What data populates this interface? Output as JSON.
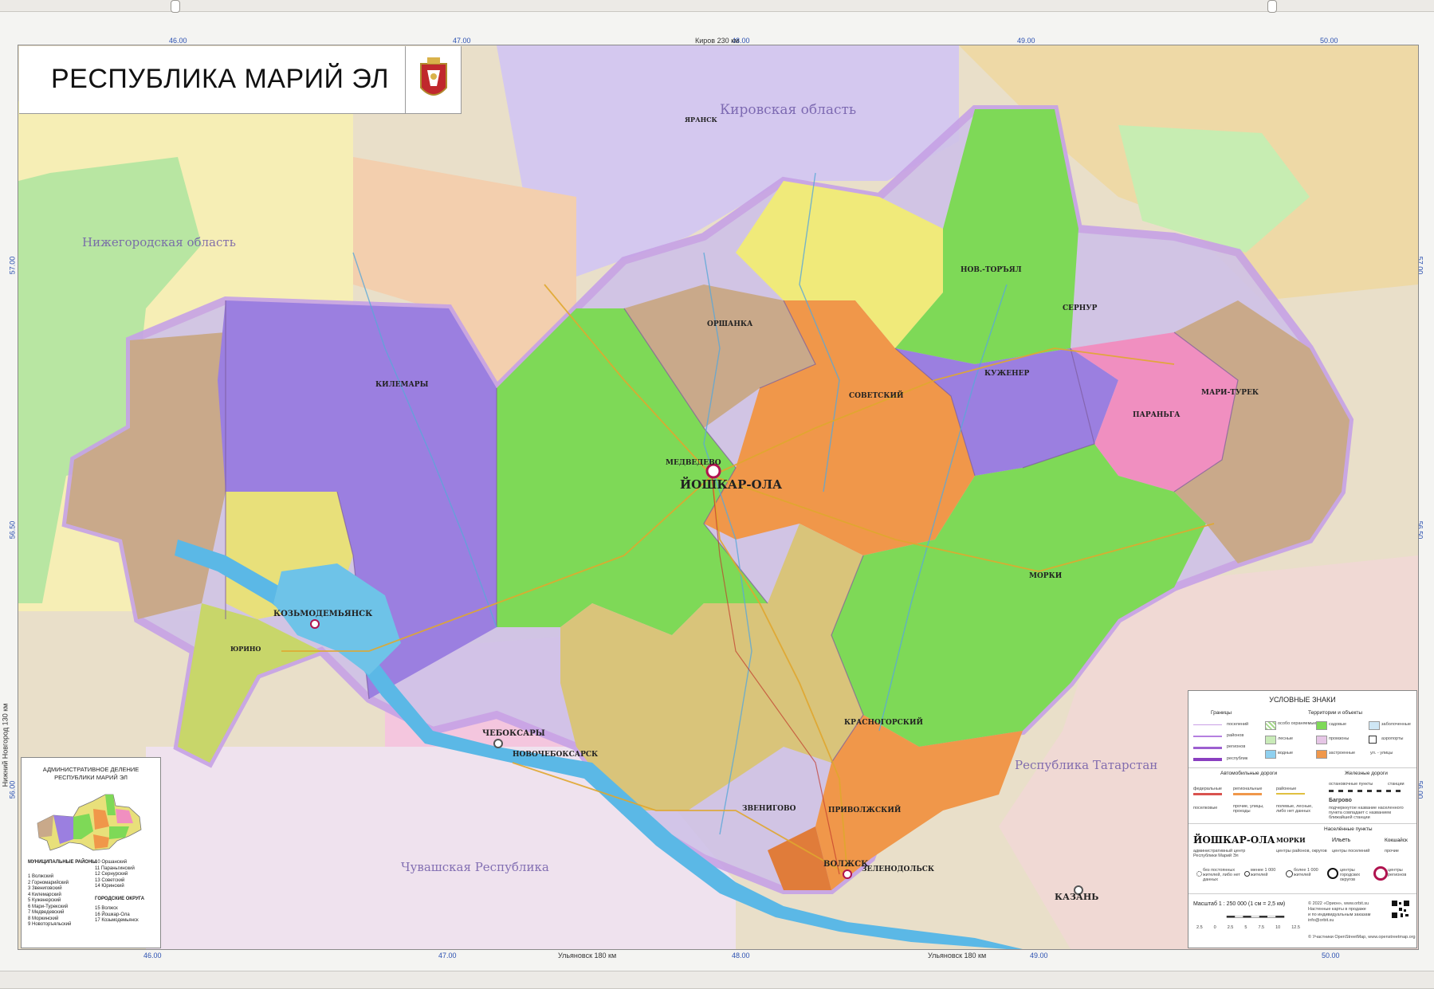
{
  "title": "РЕСПУБЛИКА МАРИЙ ЭЛ",
  "emblem_icon": "republic-emblem-icon",
  "colors": {
    "water": "#6ec3e8",
    "volga_lake": "#5bb8e6",
    "border": "#b26fd6",
    "district_green": "#7ed957",
    "district_purple": "#9b7fe0",
    "district_orange": "#f0974a",
    "district_pink": "#f08fc0",
    "district_tan": "#c9a98a",
    "district_yellow": "#e8e07a",
    "district_khaki": "#d9c47a",
    "outside_lilac": "#d4c8ef",
    "outside_peach": "#f3cfae",
    "outside_green": "#b8e6a2"
  },
  "coordinates": {
    "top": [
      "46.00",
      "47.00",
      "48.00",
      "49.00",
      "50.00"
    ],
    "bottom": [
      "46.00",
      "47.00",
      "48.00",
      "49.00",
      "50.00"
    ],
    "left": [
      "57.00",
      "56.50",
      "56.00"
    ],
    "right": [
      "57.00",
      "56.50",
      "56.00"
    ],
    "top_note": "Киров 230 км",
    "bottom_note_left": "Ульяновск 180 км",
    "bottom_note_right": "Ульяновск 180 км",
    "left_note": "Нижний Новгород 130 км"
  },
  "regions": {
    "kirov": "Кировская область",
    "nizhny": "Нижегородская область",
    "tatarstan": "Республика Татарстан",
    "chuvash": "Чувашская Республика"
  },
  "cities": {
    "capital": "ЙОШКАР-ОЛА",
    "kozmodemyansk": "КОЗЬМОДЕМЬЯНСК",
    "volzhsk": "ВОЛЖСК",
    "cheboksary": "ЧЕБОКСАРЫ",
    "novocheboksarsk": "НОВОЧЕБОКСАРСК",
    "kazan": "КАЗАНЬ",
    "zelenodolsk": "ЗЕЛЕНОДОЛЬСК",
    "medvedevo": "МЕДВЕДЕВО",
    "kilemary": "КИЛЕМАРЫ",
    "orshanka": "ОРШАНКА",
    "sovetsky": "СОВЕТСКИЙ",
    "novy_torial": "НОВ.-ТОРЪЯЛ",
    "sernur": "СЕРНУР",
    "kuzhener": "КУЖЕНЕР",
    "mari_turek": "МАРИ-ТУРЕК",
    "paranga": "ПАРАНЬГА",
    "morki": "МОРКИ",
    "zvenigovo": "ЗВЕНИГОВО",
    "krasnogorsky": "КРАСНОГОРСКИЙ",
    "privolzhsky": "ПРИВОЛЖСКИЙ",
    "yurino": "ЮРИНО",
    "yaransk": "ЯРАНСК",
    "kuzhener2": "КУЖЕНЕР"
  },
  "legend": {
    "title": "УСЛОВНЫЕ ЗНАКИ",
    "borders_head": "Границы",
    "borders": [
      "поселений",
      "районов",
      "регионов",
      "республик"
    ],
    "territories_head": "Территории и объекты",
    "territories": [
      "особо охраняемые",
      "лесные",
      "водные",
      "садовые",
      "промзоны",
      "застроенные",
      "заболоченные",
      "аэропорты",
      "ул. - улицы"
    ],
    "roads_head": "Автомобильные дороги",
    "roads": [
      "федеральные",
      "региональные",
      "районные",
      "поселковые",
      "прочие, улицы, проезды",
      "полевые, лесные, либо нет данных"
    ],
    "rail_head": "Железные дороги",
    "rail": [
      "остановочные пункты",
      "станции",
      "Багрово",
      "подчеркнутое название населенного пункта совпадает с названием ближайшей станции"
    ],
    "settlements_head": "Населённые пункты",
    "capital_sample": "ЙОШКАР-ОЛА",
    "capital_desc": "административный центр Республики Марий Эл",
    "district_sample": "МОРКИ",
    "district_desc": "центры районов, округов",
    "village_sample": "Ильеть",
    "village_desc": "центры поселений",
    "other_sample": "Кокшайск",
    "other_desc": "прочие",
    "pop": [
      "без постоянных жителей, либо нет данных",
      "менее 1 000 жителей",
      "более 1 000 жителей",
      "центры городских округов",
      "центры регионов"
    ],
    "scale": "Масштаб 1 : 250 000   (1 см = 2,5 км)",
    "scale_ticks": [
      "2.5",
      "0",
      "2.5",
      "5",
      "7.5",
      "10",
      "12.5"
    ],
    "copyright": "© 2022 «Орион», www.orbit.su\nНастенные карты в продаже\nи по индивидуальным заказам\ninfo@orbit.su",
    "osm": "© Участники OpenStreetMap, www.openstreetmap.org"
  },
  "inset": {
    "title": "АДМИНИСТРАТИВНОЕ ДЕЛЕНИЕ РЕСПУБЛИКИ МАРИЙ ЭЛ",
    "municipal_head": "МУНИЦИПАЛЬНЫЕ РАЙОНЫ",
    "municipal": [
      "1  Волжский",
      "2  Горномарийский",
      "3  Звениговский",
      "4  Килемарский",
      "5  Куженерский",
      "6  Мари-Турекский",
      "7  Медведевский",
      "8  Моркинский",
      "9  Новоторъяльский"
    ],
    "municipal2": [
      "10  Оршанский",
      "11  Параньгинский",
      "12  Сернурский",
      "13  Советский",
      "14  Юринский"
    ],
    "urban_head": "ГОРОДСКИЕ ОКРУГА",
    "urban": [
      "15  Волжск",
      "16  Йошкар-Ола",
      "17  Козьмодемьянск"
    ]
  }
}
